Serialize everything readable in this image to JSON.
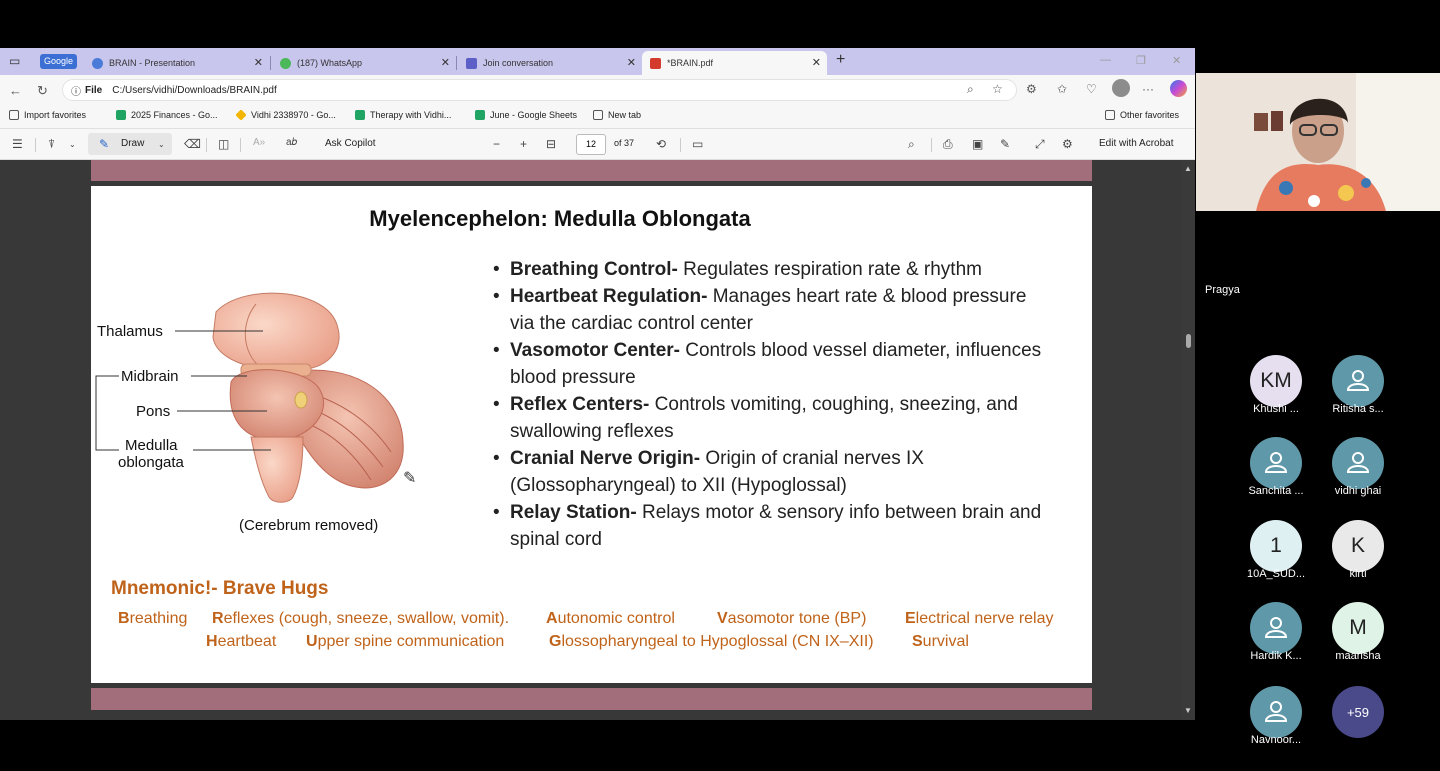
{
  "tabs": {
    "group_badge": "Google",
    "items": [
      {
        "label": "BRAIN - Presentation"
      },
      {
        "label": "(187) WhatsApp"
      },
      {
        "label": "Join conversation"
      },
      {
        "label": "*BRAIN.pdf"
      }
    ]
  },
  "address": {
    "scheme_label": "File",
    "url": "C:/Users/vidhi/Downloads/BRAIN.pdf"
  },
  "favorites": {
    "items": [
      {
        "label": "Import favorites"
      },
      {
        "label": "2025 Finances - Go..."
      },
      {
        "label": "Vidhi 2338970 - Go..."
      },
      {
        "label": "Therapy with Vidhi..."
      },
      {
        "label": "June - Google Sheets"
      },
      {
        "label": "New tab"
      }
    ],
    "other": "Other favorites"
  },
  "pdf_toolbar": {
    "draw_label": "Draw",
    "copilot_label": "Ask Copilot",
    "current_page": "12",
    "page_total": "of 37",
    "acrobat_label": "Edit with Acrobat"
  },
  "slide": {
    "title": "Myelencephelon: Medulla Oblongata",
    "bullets": [
      {
        "term": "Breathing Control-",
        "text": " Regulates respiration rate & rhythm"
      },
      {
        "term": "Heartbeat Regulation-",
        "text": " Manages heart rate & blood pressure via the cardiac control center"
      },
      {
        "term": "Vasomotor Center-",
        "text": " Controls blood vessel diameter, influences blood pressure"
      },
      {
        "term": "Reflex Centers-",
        "text": " Controls vomiting, coughing, sneezing, and swallowing reflexes"
      },
      {
        "term": "Cranial Nerve Origin-",
        "text": " Origin of cranial nerves IX (Glossopharyngeal) to XII (Hypoglossal)"
      },
      {
        "term": "Relay Station-",
        "text": " Relays motor & sensory info between brain and spinal cord"
      }
    ],
    "figure": {
      "labels": {
        "thalamus": "Thalamus",
        "midbrain": "Midbrain",
        "pons": "Pons",
        "medulla_1": "Medulla",
        "medulla_2": "oblongata"
      },
      "caption": "(Cerebrum removed)"
    },
    "mnemonic": {
      "title": "Mnemonic!- Brave Hugs",
      "row1": [
        {
          "initial": "B",
          "rest": "reathing"
        },
        {
          "initial": "R",
          "rest": "eflexes (cough, sneeze, swallow, vomit)."
        },
        {
          "initial": "A",
          "rest": "utonomic control"
        },
        {
          "initial": "V",
          "rest": "asomotor tone (BP)"
        },
        {
          "initial": "E",
          "rest": "lectrical nerve relay"
        }
      ],
      "row2": [
        {
          "initial": "H",
          "rest": "eartbeat"
        },
        {
          "initial": "U",
          "rest": "pper spine communication"
        },
        {
          "initial": "G",
          "rest": "lossopharyngeal to Hypoglossal (CN IX–XII)"
        },
        {
          "initial": "S",
          "rest": "urvival"
        }
      ]
    }
  },
  "meeting": {
    "presenter": "Pragya",
    "participants": [
      {
        "initials": "KM",
        "name": "Khushi ...",
        "kind": "initials",
        "color": "#e6dff0"
      },
      {
        "initials": "",
        "name": "Ritisha s...",
        "kind": "person",
        "color": "#5f98a8"
      },
      {
        "initials": "",
        "name": "Sanchita ...",
        "kind": "person",
        "color": "#5f98a8"
      },
      {
        "initials": "",
        "name": "vidhi ghai",
        "kind": "person",
        "color": "#5f98a8"
      },
      {
        "initials": "1",
        "name": "10A_SUD...",
        "kind": "initials",
        "color": "#dff0f3"
      },
      {
        "initials": "K",
        "name": "kirti",
        "kind": "initials",
        "color": "#e9e9e9"
      },
      {
        "initials": "",
        "name": "Hardik K...",
        "kind": "person",
        "color": "#5f98a8"
      },
      {
        "initials": "M",
        "name": "maarisha",
        "kind": "initials",
        "color": "#dff3e6"
      },
      {
        "initials": "",
        "name": "Navnoor...",
        "kind": "person",
        "color": "#5f98a8"
      },
      {
        "initials": "+59",
        "name": "",
        "kind": "more",
        "color": "#4a4a8a"
      }
    ]
  }
}
